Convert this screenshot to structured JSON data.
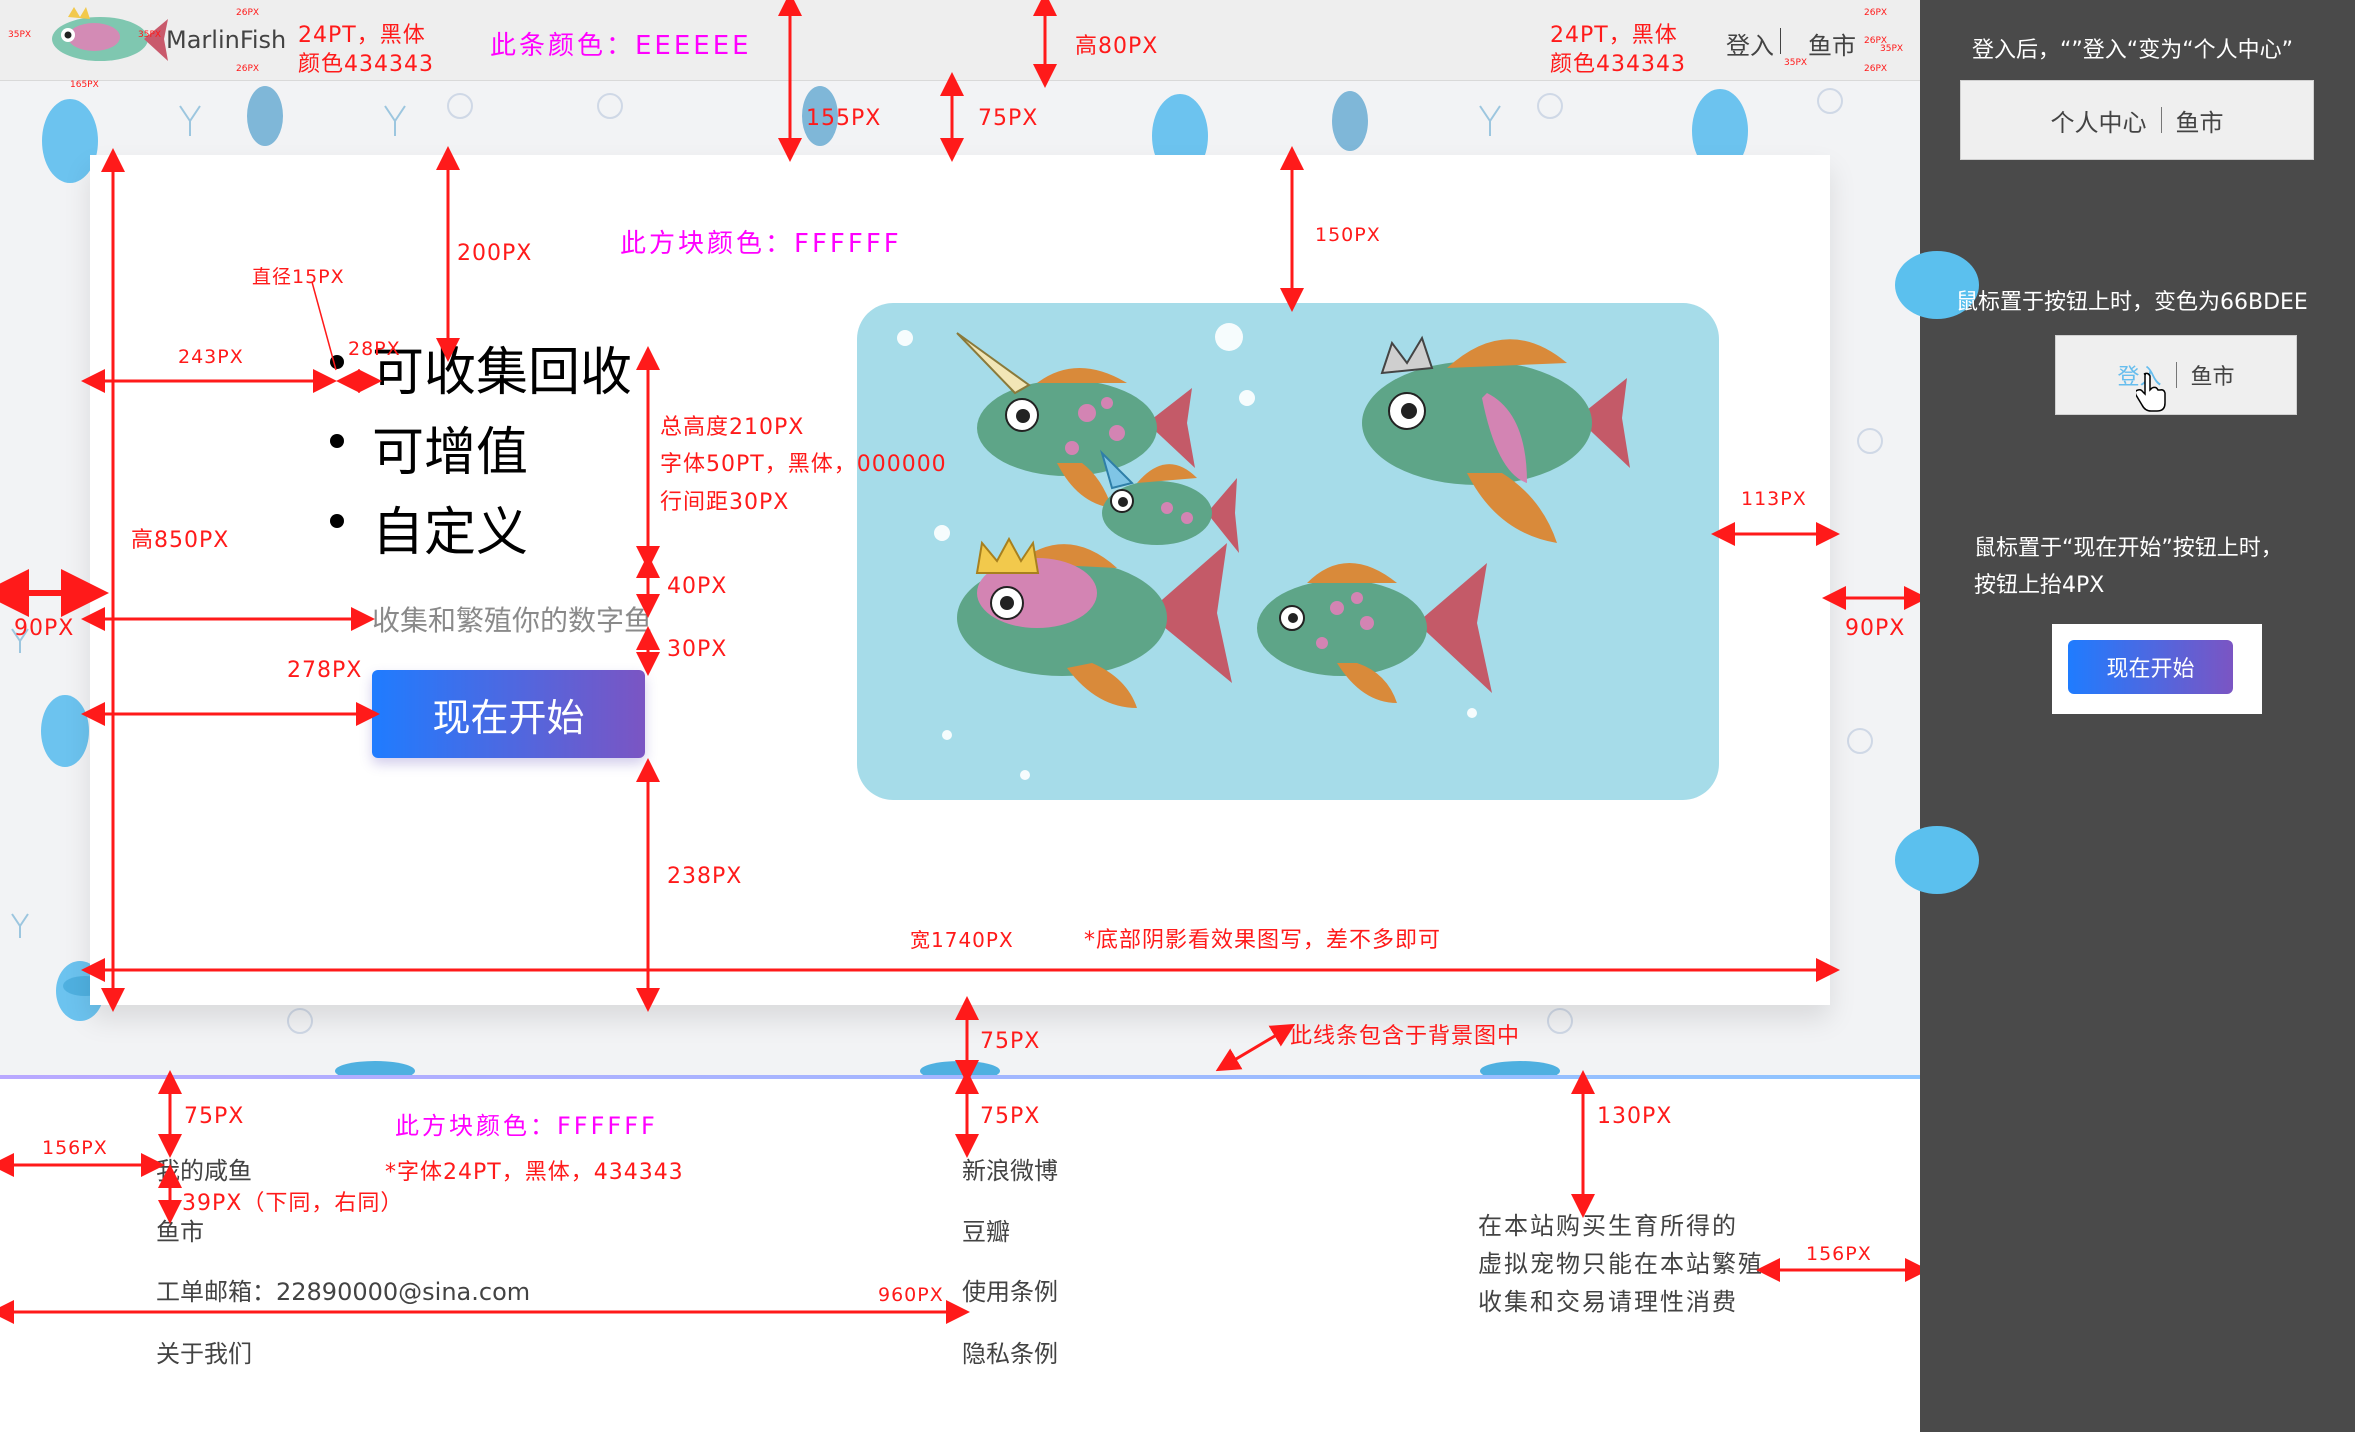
{
  "header": {
    "brand": "MarlinFish",
    "font_note_left": "24PT，黑体",
    "color_note_left": "颜色434343",
    "bar_color_note": "此条颜色：EEEEEE",
    "height_note": "高80PX",
    "font_note_right": "24PT，黑体",
    "color_note_right": "颜色434343",
    "nav_login": "登入",
    "nav_market": "鱼市",
    "tiny_labels": [
      "35PX",
      "26PX",
      "35PX",
      "26PX",
      "165PX",
      "26PX",
      "35PX",
      "35PX",
      "26PX",
      "26PX"
    ]
  },
  "hero": {
    "card_color_note": "此方块颜色：FFFFFF",
    "bullets": [
      "可收集回收",
      "可增值",
      "自定义"
    ],
    "tagline": "收集和繁殖你的数字鱼",
    "start_button": "现在开始",
    "image_alt": "fish-illustration"
  },
  "annotations": {
    "d155": "155PX",
    "d75_top": "75PX",
    "d200": "200PX",
    "d150": "150PX",
    "dot_note": "直径15PX",
    "d243": "243PX",
    "d28": "28PX",
    "text_block_note": [
      "总高度210PX",
      "字体50PT，黑体，000000",
      "行间距30PX"
    ],
    "d40": "40PX",
    "d30": "30PX",
    "h850": "高850PX",
    "d90_left": "90PX",
    "d278": "278PX",
    "d113": "113PX",
    "d90_right": "90PX",
    "d238": "238PX",
    "w1740": "宽1740PX",
    "shadow_note": "*底部阴影看效果图写，差不多即可",
    "d75_mid": "75PX",
    "bg_line_note": "此线条包含于背景图中",
    "d75_footer_left": "75PX",
    "footer_color_note": "此方块颜色：FFFFFF",
    "d75_footer_mid": "75PX",
    "d130": "130PX",
    "d156_left": "156PX",
    "footer_font_note": "*字体24PT，黑体，434343",
    "d39": "39PX（下同，右同）",
    "d960": "960PX",
    "d156_right": "156PX"
  },
  "footer": {
    "col1": [
      "我的咸鱼",
      "鱼市",
      "工单邮箱：22890000@sina.com",
      "关于我们"
    ],
    "col2": [
      "新浪微博",
      "豆瓣",
      "使用条例",
      "隐私条例"
    ],
    "notice": [
      "在本站购买生育所得的",
      "虚拟宠物只能在本站繁殖",
      "收集和交易请理性消费"
    ]
  },
  "side_panel": {
    "note_login": "登入后，“”登入“变为“个人中心”",
    "btn_center": "个人中心",
    "btn_market": "鱼市",
    "note_hover": "鼠标置于按钮上时，变色为66BDEE",
    "btn_login_hover": "登入",
    "btn_market2": "鱼市",
    "note_start": [
      "鼠标置于“现在开始”按钮上时，",
      "按钮上抬4PX"
    ],
    "start_demo": "现在开始",
    "hover_color": "#66BDEE"
  },
  "colors": {
    "header": "#EEEEEE",
    "card": "#FFFFFF",
    "text": "#434343",
    "accent_start": "#1F7CFF",
    "accent_end": "#7B55C3",
    "panel": "#4A4A4A",
    "measure": "#FF1A1A",
    "note": "#FF00FF",
    "art_bg": "#A6DCE9"
  }
}
